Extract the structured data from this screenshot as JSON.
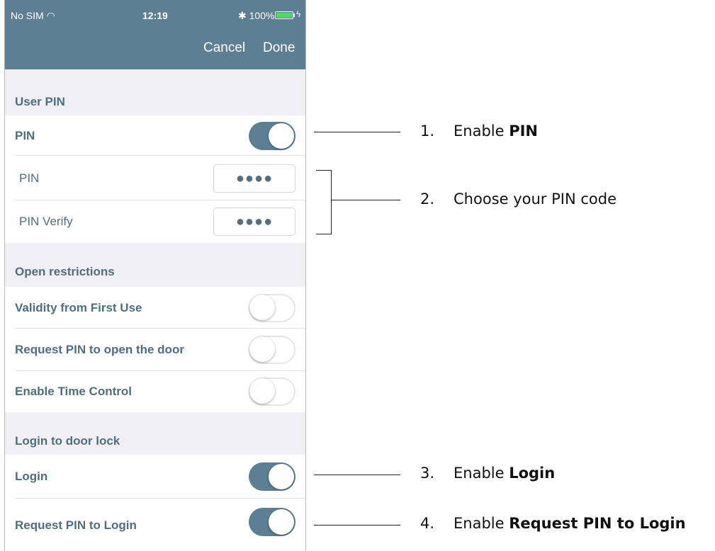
{
  "status_bar": {
    "carrier": "No SIM ◠",
    "time": "12:19",
    "right": "✱ 100%",
    "charge_icon": "ϟ",
    "icons": [
      "wifi-icon",
      "bluetooth-icon",
      "battery-icon",
      "charging-icon"
    ]
  },
  "nav": {
    "cancel": "Cancel",
    "done": "Done"
  },
  "sections": {
    "user_pin": {
      "header": "User PIN",
      "pin_toggle_label": "PIN",
      "pin_toggle_on": true,
      "pin_label": "PIN",
      "pin_value": "●●●●",
      "pin_verify_label": "PIN Verify",
      "pin_verify_value": "●●●●"
    },
    "open_restrictions": {
      "header": "Open restrictions",
      "items": [
        {
          "label": "Validity from First Use",
          "on": false
        },
        {
          "label": "Request PIN to open the door",
          "on": false
        },
        {
          "label": "Enable Time Control",
          "on": false
        }
      ]
    },
    "login": {
      "header": "Login to door lock",
      "items": [
        {
          "label": "Login",
          "on": true
        },
        {
          "label": "Request PIN to Login",
          "on": true
        }
      ]
    }
  },
  "annotations": [
    {
      "num": "1.",
      "text": "Enable ",
      "bold": "PIN"
    },
    {
      "num": "2.",
      "text": "Choose your PIN code",
      "bold": ""
    },
    {
      "num": "3.",
      "text": "Enable ",
      "bold": "Login"
    },
    {
      "num": "4.",
      "text": "Enable ",
      "bold": "Request PIN to Login"
    }
  ],
  "colors": {
    "accent": "#5d7f93",
    "text": "#4f6e80",
    "section_bg": "#efeff4",
    "battery": "#4cd964"
  }
}
